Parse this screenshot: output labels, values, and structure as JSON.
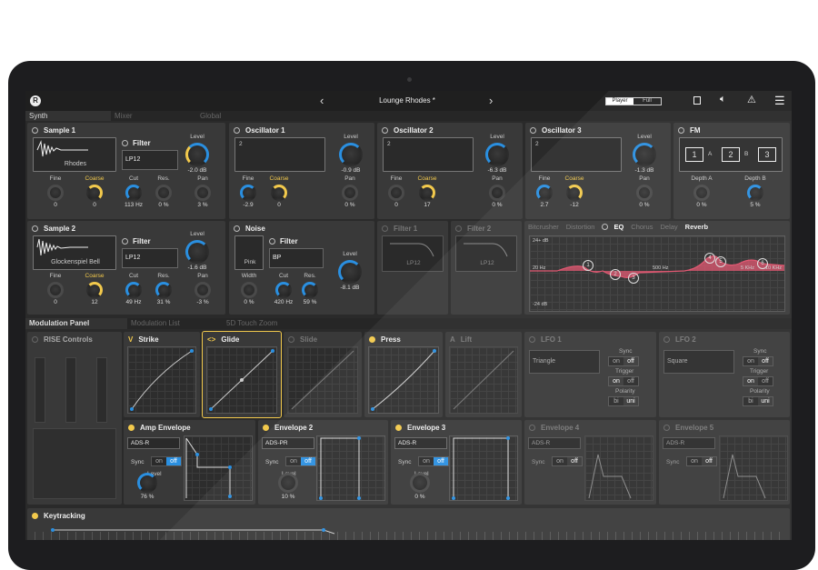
{
  "preset": "Lounge Rhodes *",
  "mode": {
    "player": "Player",
    "full": "Full"
  },
  "top_tabs": [
    "Synth",
    "Mixer",
    "Global"
  ],
  "sample1": {
    "title": "Sample 1",
    "wave": "Rhodes",
    "filter_title": "Filter",
    "filter": "LP12",
    "level_label": "Level",
    "level": "-2.0 dB",
    "fine_label": "Fine",
    "fine": "0",
    "coarse_label": "Coarse",
    "coarse": "0",
    "cut_label": "Cut",
    "cut": "113 Hz",
    "res_label": "Res.",
    "res": "0 %",
    "pan_label": "Pan",
    "pan": "3 %"
  },
  "osc1": {
    "title": "Oscillator 1",
    "num": "2",
    "level_label": "Level",
    "level": "-0.9 dB",
    "fine_label": "Fine",
    "fine": "-2.9",
    "coarse_label": "Coarse",
    "coarse": "0",
    "pan_label": "Pan",
    "pan": "0 %"
  },
  "osc2": {
    "title": "Oscillator 2",
    "num": "2",
    "level_label": "Level",
    "level": "-6.3 dB",
    "fine_label": "Fine",
    "fine": "0",
    "coarse_label": "Coarse",
    "coarse": "17",
    "pan_label": "Pan",
    "pan": "0 %"
  },
  "osc3": {
    "title": "Oscillator 3",
    "num": "2",
    "level_label": "Level",
    "level": "-1.3 dB",
    "fine_label": "Fine",
    "fine": "2.7",
    "coarse_label": "Coarse",
    "coarse": "-12",
    "pan_label": "Pan",
    "pan": "0 %"
  },
  "fm": {
    "title": "FM",
    "b1": "1",
    "b2": "2",
    "b3": "3",
    "a": "A",
    "b": "B",
    "depth_a_label": "Depth A",
    "depth_a": "0 %",
    "depth_b_label": "Depth B",
    "depth_b": "5 %"
  },
  "sample2": {
    "title": "Sample 2",
    "wave": "Glockenspiel Bell",
    "filter_title": "Filter",
    "filter": "LP12",
    "level_label": "Level",
    "level": "-1.6 dB",
    "fine_label": "Fine",
    "fine": "0",
    "coarse_label": "Coarse",
    "coarse": "12",
    "cut_label": "Cut",
    "cut": "49 Hz",
    "res_label": "Res.",
    "res": "31 %",
    "pan_label": "Pan",
    "pan": "-3 %"
  },
  "noise": {
    "title": "Noise",
    "filter_title": "Filter",
    "color": "Pink",
    "filter": "BP",
    "width_label": "Width",
    "width": "0 %",
    "cut_label": "Cut",
    "cut": "420 Hz",
    "res_label": "Res.",
    "res": "59 %",
    "level_label": "Level",
    "level": "-8.1 dB"
  },
  "filter1": {
    "title": "Filter 1",
    "type": "LP12"
  },
  "filter2": {
    "title": "Filter 2",
    "type": "LP12"
  },
  "fx_tabs": [
    "Bitcrusher",
    "Distortion",
    "EQ",
    "Chorus",
    "Delay",
    "Reverb"
  ],
  "eq": {
    "top": "24+ dB",
    "bottom": "-24 dB",
    "f1": "20 Hz",
    "f2": "500 Hz",
    "f3": "5 KHz",
    "f4": "10 KHz",
    "nodes": [
      "1",
      "2",
      "3",
      "4",
      "5",
      "6"
    ]
  },
  "mod_tabs": [
    "Modulation Panel",
    "Modulation List",
    "5D Touch Zoom"
  ],
  "rise": {
    "title": "RISE Controls"
  },
  "strike": {
    "title": "Strike"
  },
  "glide": {
    "title": "Glide"
  },
  "slide": {
    "title": "Slide"
  },
  "press": {
    "title": "Press"
  },
  "lift": {
    "title": "Lift"
  },
  "lfo1": {
    "title": "LFO 1",
    "shape": "Triangle",
    "sync": "Sync",
    "trigger": "Trigger",
    "polarity": "Polarity",
    "on": "on",
    "off": "off",
    "bi": "bi",
    "uni": "uni"
  },
  "lfo2": {
    "title": "LFO 2",
    "shape": "Square",
    "sync": "Sync",
    "trigger": "Trigger",
    "polarity": "Polarity",
    "on": "on",
    "off": "off",
    "bi": "bi",
    "uni": "uni"
  },
  "env_amp": {
    "title": "Amp Envelope",
    "mode": "ADS-R",
    "sync": "Sync",
    "on": "on",
    "off": "off",
    "level_label": "Level",
    "level": "76 %"
  },
  "env2": {
    "title": "Envelope 2",
    "mode": "ADS-PR",
    "sync": "Sync",
    "on": "on",
    "off": "off",
    "level_label": "Level",
    "level": "10 %"
  },
  "env3": {
    "title": "Envelope 3",
    "mode": "ADS-R",
    "sync": "Sync",
    "on": "on",
    "off": "off",
    "level_label": "Level",
    "level": "0 %"
  },
  "env4": {
    "title": "Envelope 4",
    "mode": "ADS-R",
    "sync": "Sync",
    "on": "on",
    "off": "off"
  },
  "env5": {
    "title": "Envelope 5",
    "mode": "ADS-R",
    "sync": "Sync",
    "on": "on",
    "off": "off"
  },
  "keytracking": {
    "title": "Keytracking"
  },
  "colors": {
    "accent_blue": "#2a8fe0",
    "accent_yellow": "#f2c94c",
    "eq_pink": "#e0506b"
  }
}
